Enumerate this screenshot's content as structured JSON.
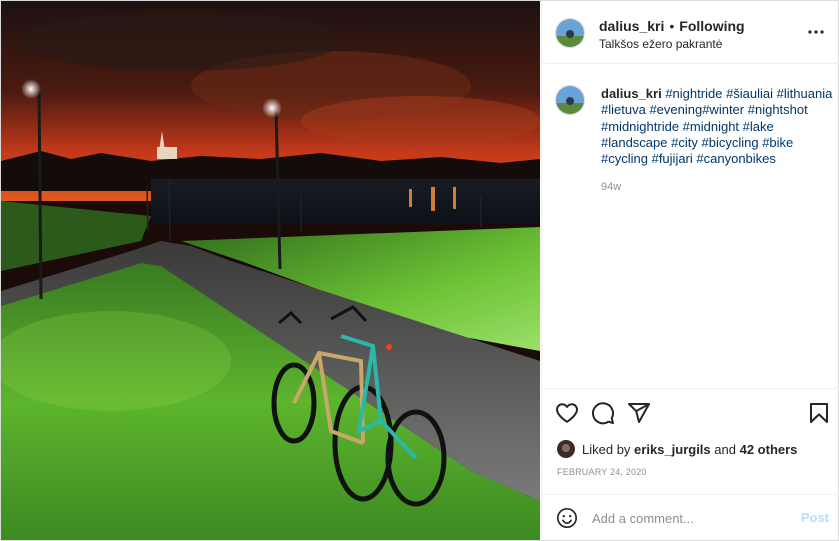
{
  "post": {
    "author": {
      "username": "dalius_kri",
      "follow_status": "Following",
      "separator": "•"
    },
    "location": "Talkšos ežero pakrantė",
    "caption": {
      "username": "dalius_kri",
      "tags": [
        "#nightride",
        "#šiauliai",
        "#lithuania",
        "#lietuva",
        "#evening#winter",
        "#nightshot",
        "#midnightride",
        "#midnight",
        "#lake",
        "#landscape",
        "#city",
        "#bicycling",
        "#bike",
        "#cycling",
        "#fujijari",
        "#canyonbikes"
      ]
    },
    "time_ago": "94w",
    "likes": {
      "prefix": "Liked by",
      "user": "eriks_jurgils",
      "joiner": "and",
      "others": "42 others"
    },
    "date": "FEBRUARY 24, 2020",
    "comment": {
      "placeholder": "Add a comment...",
      "post_label": "Post"
    }
  },
  "icons": {
    "more": "more-options-icon",
    "like": "heart-icon",
    "comment": "comment-icon",
    "share": "share-icon",
    "save": "bookmark-icon",
    "emoji": "emoji-icon"
  },
  "colors": {
    "text": "#262626",
    "secondary": "#8e8e8e",
    "hashtag": "#00376b",
    "post_disabled": "#b2dffc",
    "border": "#dbdbdb"
  }
}
